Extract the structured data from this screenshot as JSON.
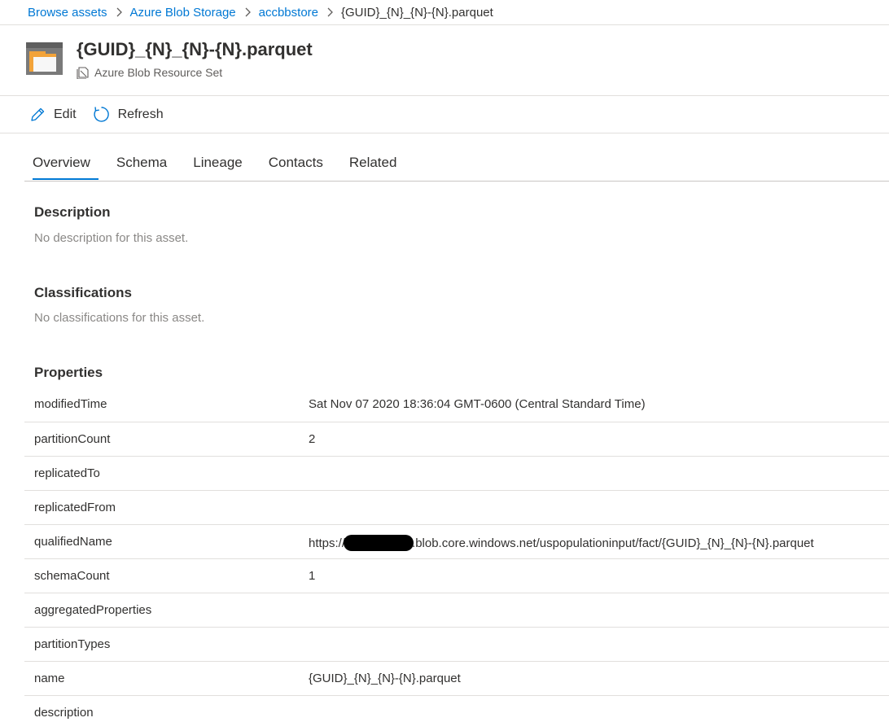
{
  "breadcrumb": {
    "items": [
      "Browse assets",
      "Azure Blob Storage",
      "accbbstore"
    ],
    "current": "{GUID}_{N}_{N}-{N}.parquet"
  },
  "asset": {
    "title": "{GUID}_{N}_{N}-{N}.parquet",
    "type": "Azure Blob Resource Set",
    "icon": "folder-icon"
  },
  "toolbar": {
    "edit_label": "Edit",
    "refresh_label": "Refresh"
  },
  "tabs": [
    {
      "label": "Overview",
      "active": true
    },
    {
      "label": "Schema"
    },
    {
      "label": "Lineage"
    },
    {
      "label": "Contacts"
    },
    {
      "label": "Related"
    }
  ],
  "overview": {
    "description_title": "Description",
    "description_empty": "No description for this asset.",
    "classifications_title": "Classifications",
    "classifications_empty": "No classifications for this asset.",
    "properties_title": "Properties"
  },
  "properties": [
    {
      "key": "modifiedTime",
      "value": "Sat Nov 07 2020 18:36:04 GMT-0600 (Central Standard Time)"
    },
    {
      "key": "partitionCount",
      "value": "2"
    },
    {
      "key": "replicatedTo",
      "value": ""
    },
    {
      "key": "replicatedFrom",
      "value": ""
    },
    {
      "key": "qualifiedName",
      "value_prefix": "https://",
      "value_suffix": ".blob.core.windows.net/uspopulationinput/fact/{GUID}_{N}_{N}-{N}.parquet"
    },
    {
      "key": "schemaCount",
      "value": "1"
    },
    {
      "key": "aggregatedProperties",
      "value": ""
    },
    {
      "key": "partitionTypes",
      "value": ""
    },
    {
      "key": "name",
      "value": "{GUID}_{N}_{N}-{N}.parquet"
    },
    {
      "key": "description",
      "value": ""
    }
  ],
  "colors": {
    "accent": "#0078d4",
    "text": "#323130",
    "muted": "#8a8886",
    "border": "#e1dfdd",
    "folder": "#f2a33a"
  }
}
